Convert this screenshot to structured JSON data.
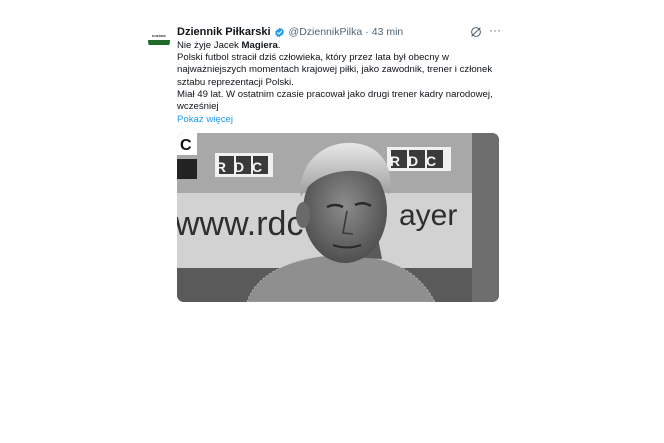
{
  "tweet": {
    "author_name": "Dziennik Piłkarski",
    "handle": "@DziennikPilka",
    "separator": "·",
    "time": "43 min",
    "avatar_text": "DZIENNIK",
    "more_icon": "···",
    "text": {
      "line1_prefix": "Nie żyje Jacek ",
      "line1_bold": "Magiera",
      "line1_suffix": ".",
      "para2": "Polski futbol stracił dziś człowieka, który przez lata był obecny w najważniejszych momentach krajowej piłki, jako zawodnik, trener i członek sztabu reprezentacji Polski.",
      "para3": "Miał 49 lat. W ostatnim czasie pracował jako drugi trener kadry narodowej, wcześniej"
    },
    "show_more": "Pokaż więcej",
    "media": {
      "sign_left": "RDC",
      "sign_right": "RDC",
      "banner_left": "www.rdc",
      "banner_right": "ayer",
      "corner_letter": "C"
    }
  },
  "colors": {
    "text": "#0f1419",
    "secondary": "#536471",
    "link": "#1d9bf0",
    "verified": "#1d9bf0",
    "avatar_brand": "#1e6b2a"
  },
  "icons": [
    "verified-badge-icon",
    "grok-icon",
    "more-icon"
  ]
}
